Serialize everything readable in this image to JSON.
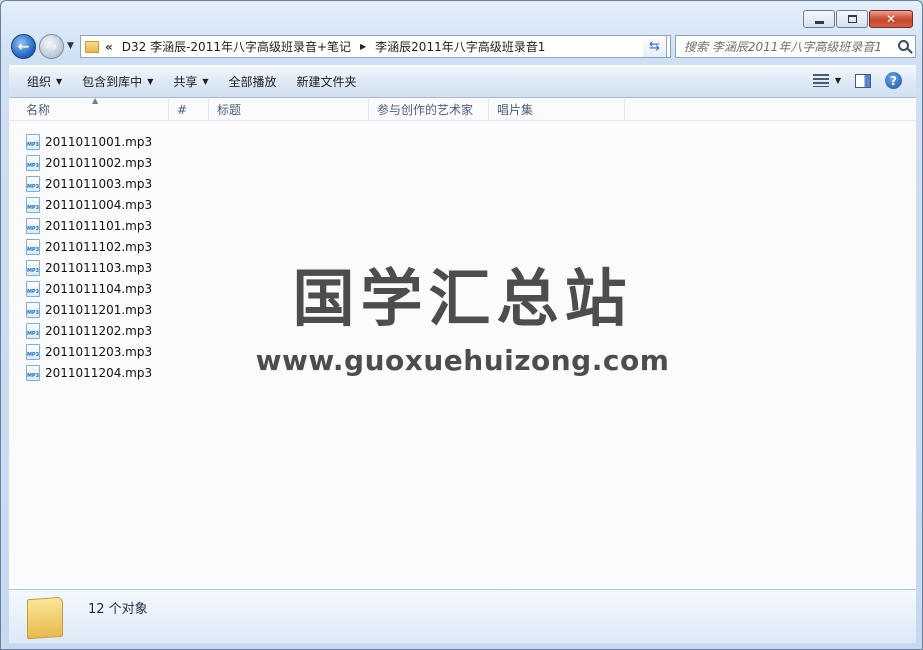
{
  "window": {
    "controls": {
      "minimize": "",
      "maximize": "",
      "close": "✕"
    }
  },
  "nav": {
    "address": {
      "overflow": "«",
      "segments": [
        "D32 李涵辰-2011年八字高级班录音+笔记",
        "李涵辰2011年八字高级班录音1"
      ]
    },
    "search_placeholder": "搜索 李涵辰2011年八字高级班录音1"
  },
  "toolbar": {
    "items": [
      {
        "label": "组织",
        "dropdown": true
      },
      {
        "label": "包含到库中",
        "dropdown": true
      },
      {
        "label": "共享",
        "dropdown": true
      },
      {
        "label": "全部播放",
        "dropdown": false
      },
      {
        "label": "新建文件夹",
        "dropdown": false
      }
    ],
    "help": "?"
  },
  "columns": [
    "名称",
    "#",
    "标题",
    "参与创作的艺术家",
    "唱片集"
  ],
  "files": [
    "2011011001.mp3",
    "2011011002.mp3",
    "2011011003.mp3",
    "2011011004.mp3",
    "2011011101.mp3",
    "2011011102.mp3",
    "2011011103.mp3",
    "2011011104.mp3",
    "2011011201.mp3",
    "2011011202.mp3",
    "2011011203.mp3",
    "2011011204.mp3"
  ],
  "file_icon_label": "MP3",
  "watermark": {
    "title": "国学汇总站",
    "url": "www.guoxuehuizong.com"
  },
  "status": {
    "text": "12 个对象"
  }
}
